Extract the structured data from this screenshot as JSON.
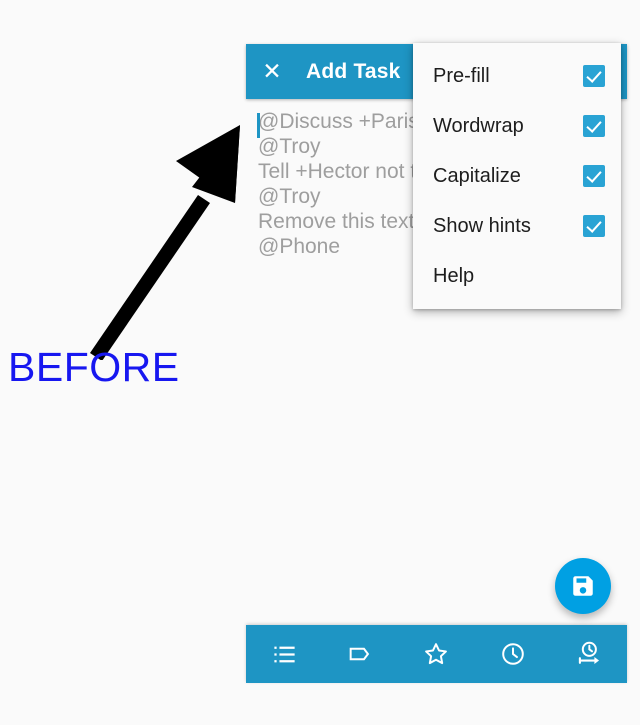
{
  "window": {
    "background_color": "#fafafa",
    "accent_color": "#1e95c4"
  },
  "appbar": {
    "close_icon": "close-icon",
    "close_glyph": "✕",
    "title": "Add Task"
  },
  "editor": {
    "caret_visible": true,
    "lines": [
      "@Discuss +Paris",
      "@Troy",
      "Tell +Hector not to",
      "@Troy",
      "Remove this text",
      "@Phone"
    ],
    "hint_color": "#9e9e9e"
  },
  "menu": {
    "items": [
      {
        "label": "Pre-fill",
        "checkbox": true,
        "checked": true
      },
      {
        "label": "Wordwrap",
        "checkbox": true,
        "checked": true
      },
      {
        "label": "Capitalize",
        "checkbox": true,
        "checked": true
      },
      {
        "label": "Show hints",
        "checkbox": true,
        "checked": true
      },
      {
        "label": "Help",
        "checkbox": false,
        "checked": false
      }
    ],
    "checkbox_color": "#29a3d4"
  },
  "fab": {
    "icon": "save-floppy-icon",
    "color": "#00a0e3"
  },
  "bottombar": {
    "buttons": [
      {
        "icon": "list-icon"
      },
      {
        "icon": "tag-label-icon"
      },
      {
        "icon": "star-icon"
      },
      {
        "icon": "clock-icon"
      },
      {
        "icon": "clock-duration-arrow-icon"
      }
    ]
  },
  "annotation": {
    "label": "BEFORE",
    "label_color": "#1717f0",
    "arrow_color": "#000000",
    "arrow_icon": "annotation-arrow-icon"
  }
}
